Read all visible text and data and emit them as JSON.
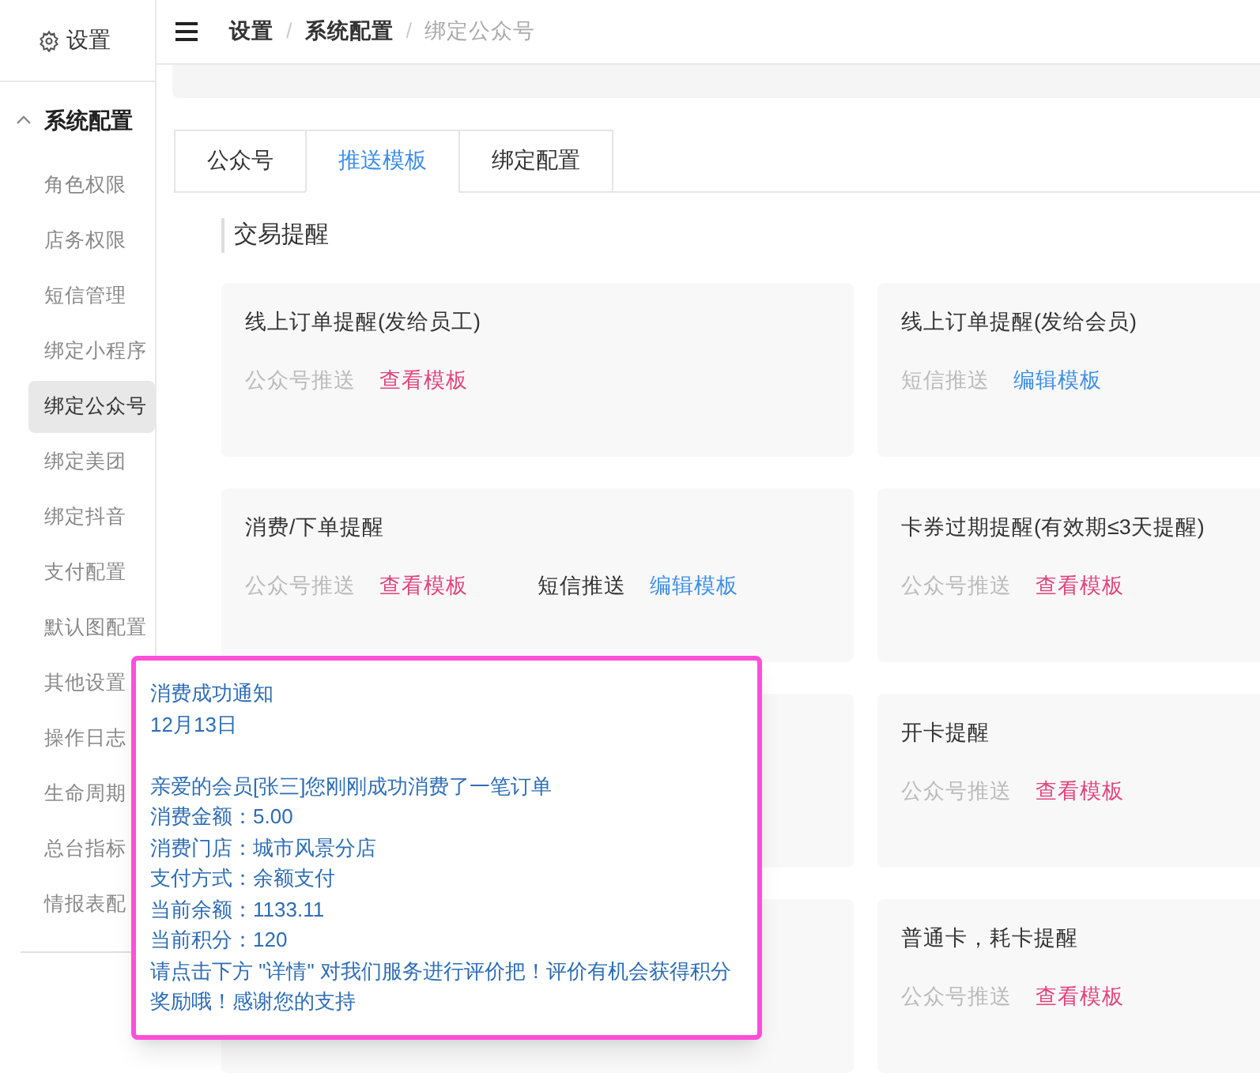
{
  "sidebar": {
    "header": "设置",
    "group": {
      "label": "系统配置",
      "expanded": true
    },
    "items": [
      {
        "label": "角色权限",
        "selected": false
      },
      {
        "label": "店务权限",
        "selected": false
      },
      {
        "label": "短信管理",
        "selected": false
      },
      {
        "label": "绑定小程序",
        "selected": false
      },
      {
        "label": "绑定公众号",
        "selected": true
      },
      {
        "label": "绑定美团",
        "selected": false
      },
      {
        "label": "绑定抖音",
        "selected": false
      },
      {
        "label": "支付配置",
        "selected": false
      },
      {
        "label": "默认图配置",
        "selected": false
      },
      {
        "label": "其他设置",
        "selected": false
      },
      {
        "label": "操作日志",
        "selected": false
      },
      {
        "label": "生命周期",
        "selected": false
      },
      {
        "label": "总台指标",
        "selected": false
      },
      {
        "label": "情报表配",
        "selected": false
      }
    ]
  },
  "breadcrumb_separator": "/",
  "breadcrumb": [
    {
      "label": "设置",
      "current": false
    },
    {
      "label": "系统配置",
      "current": false
    },
    {
      "label": "绑定公众号",
      "current": true
    }
  ],
  "tabs": [
    {
      "label": "公众号",
      "selected": false
    },
    {
      "label": "推送模板",
      "selected": true
    },
    {
      "label": "绑定配置",
      "selected": false
    }
  ],
  "section_title": "交易提醒",
  "cards": [
    {
      "title": "线上订单提醒(发给员工)",
      "channels": [
        {
          "label": "公众号推送",
          "active": false,
          "action": {
            "label": "查看模板",
            "kind": "view"
          }
        }
      ]
    },
    {
      "title": "线上订单提醒(发给会员)",
      "channels": [
        {
          "label": "短信推送",
          "active": false,
          "action": {
            "label": "编辑模板",
            "kind": "edit"
          }
        }
      ]
    },
    {
      "title": "消费/下单提醒",
      "channels": [
        {
          "label": "公众号推送",
          "active": false,
          "action": {
            "label": "查看模板",
            "kind": "view"
          }
        },
        {
          "label": "短信推送",
          "active": true,
          "action": {
            "label": "编辑模板",
            "kind": "edit"
          }
        }
      ]
    },
    {
      "title": "卡券过期提醒(有效期≤3天提醒)",
      "channels": [
        {
          "label": "公众号推送",
          "active": false,
          "action": {
            "label": "查看模板",
            "kind": "view"
          }
        }
      ]
    },
    {
      "kind": "blank"
    },
    {
      "title": "开卡提醒",
      "channels": [
        {
          "label": "公众号推送",
          "active": false,
          "action": {
            "label": "查看模板",
            "kind": "view"
          }
        }
      ]
    },
    {
      "kind": "blank"
    },
    {
      "title": "普通卡，耗卡提醒",
      "channels": [
        {
          "label": "公众号推送",
          "active": false,
          "action": {
            "label": "查看模板",
            "kind": "view"
          }
        }
      ]
    }
  ],
  "popover": {
    "title": "消费成功通知",
    "date": "12月13日",
    "lines": [
      "亲爱的会员[张三]您刚刚成功消费了一笔订单",
      "消费金额：5.00",
      "消费门店：城市风景分店",
      "支付方式：余额支付",
      "当前余额：1133.11",
      "当前积分：120",
      "请点击下方 \"详情\" 对我们服务进行评价把！评价有机会获得积分奖励哦！感谢您的支持"
    ]
  }
}
